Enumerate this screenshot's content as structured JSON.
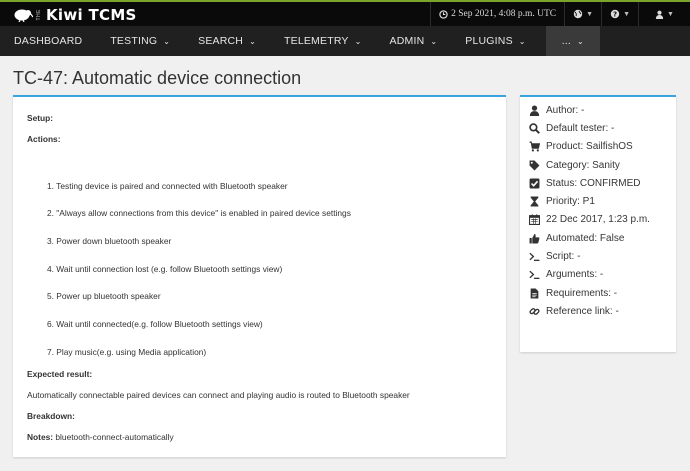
{
  "topbar": {
    "brand_prefix": "THE",
    "brand_name": "Kiwi TCMS",
    "datetime": "2 Sep 2021, 4:08 p.m. UTC"
  },
  "nav": {
    "items": [
      {
        "label": "DASHBOARD",
        "caret": false
      },
      {
        "label": "TESTING",
        "caret": true
      },
      {
        "label": "SEARCH",
        "caret": true
      },
      {
        "label": "TELEMETRY",
        "caret": true
      },
      {
        "label": "ADMIN",
        "caret": true
      },
      {
        "label": "PLUGINS",
        "caret": true
      }
    ],
    "more_label": "..."
  },
  "page": {
    "title": "TC-47: Automatic device connection"
  },
  "testcase": {
    "setup_label": "Setup:",
    "actions_label": "Actions:",
    "steps": [
      "1. Testing device is paired and connected with Bluetooth speaker",
      "2. \"Always allow connections from this device\" is enabled in paired device settings",
      "3. Power down bluetooth speaker",
      "4. Wait until connection lost (e.g. follow Bluetooth settings view)",
      "5. Power up bluetooth speaker",
      "6. Wait until connected(e.g. follow Bluetooth settings view)",
      "7. Play music(e.g. using Media application)"
    ],
    "expected_label": "Expected result:",
    "expected_text": "Automatically connectable paired devices can connect and playing audio is routed to Bluetooth speaker",
    "breakdown_label": "Breakdown:",
    "notes_label": "Notes:",
    "notes_text": "bluetooth-connect-automatically"
  },
  "details": {
    "author": "Author: -",
    "default_tester": "Default tester: -",
    "product": "Product: SailfishOS",
    "category": "Category: Sanity",
    "status": "Status: CONFIRMED",
    "priority": "Priority: P1",
    "created": "22 Dec 2017, 1:23 p.m.",
    "automated": "Automated: False",
    "script": "Script: -",
    "arguments": "Arguments: -",
    "requirements": "Requirements: -",
    "reference_link": "Reference link: -"
  },
  "colors": {
    "accent_top": "#79a52b",
    "card_border": "#39a5dc",
    "topbar_bg": "#0a0a0a",
    "navbar_bg": "#202020"
  }
}
